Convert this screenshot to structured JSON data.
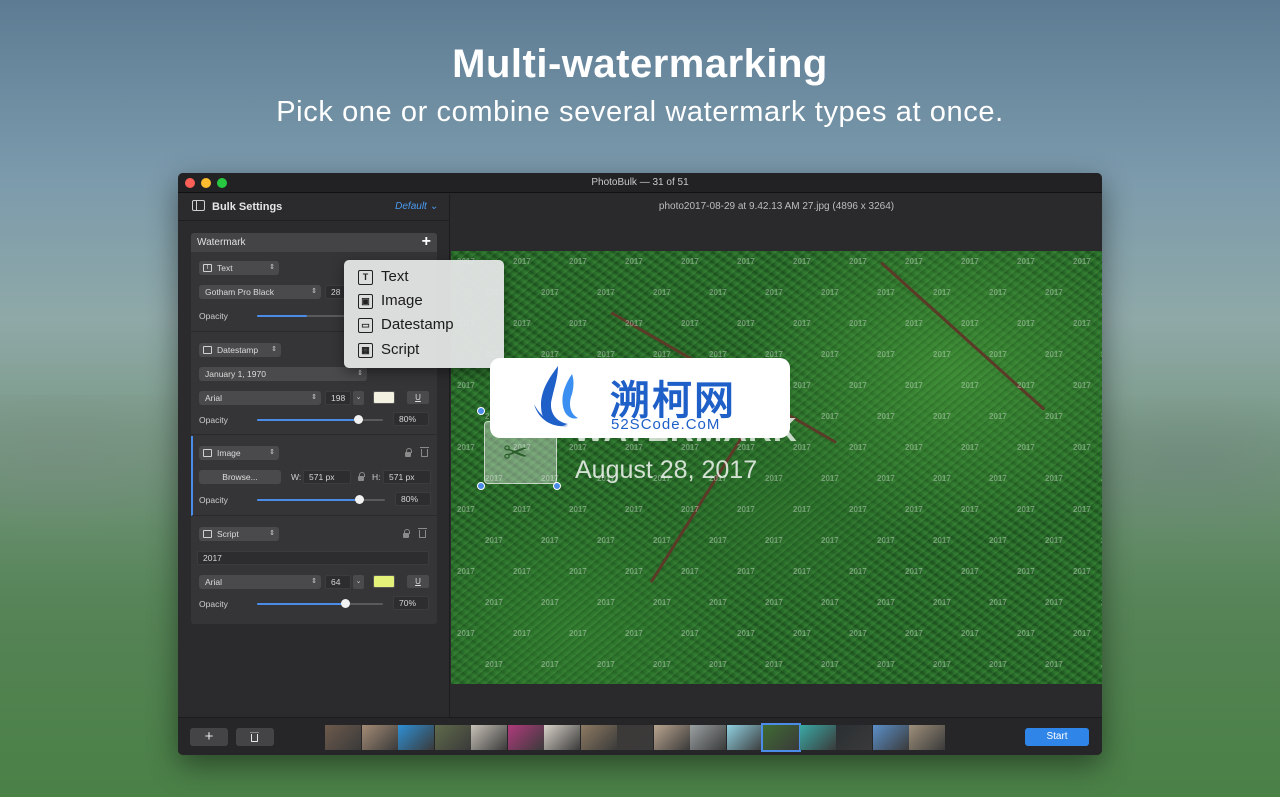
{
  "hero": {
    "title": "Multi-watermarking",
    "subtitle": "Pick one or combine several watermark types at once."
  },
  "window": {
    "title": "PhotoBulk — 31 of 51"
  },
  "sidebar": {
    "title": "Bulk Settings",
    "preset": "Default",
    "panel_title": "Watermark",
    "text_section": {
      "type": "Text",
      "font": "Gotham Pro Black",
      "size_partial": "28",
      "opacity_label": "Opacity",
      "opacity": 0.55
    },
    "datestamp_section": {
      "type": "Datestamp",
      "date_format": "January 1, 1970",
      "font": "Arial",
      "size": "198",
      "underline_label": "U",
      "color": "#f3f1e2",
      "opacity_label": "Opacity",
      "opacity_value": "80%",
      "opacity": 0.8
    },
    "image_section": {
      "type": "Image",
      "browse_label": "Browse...",
      "width_label": "W:",
      "width_value": "571 px",
      "height_label": "H:",
      "height_value": "571 px",
      "opacity_label": "Opacity",
      "opacity_value": "80%",
      "opacity": 0.8
    },
    "script_section": {
      "type": "Script",
      "script_value": "2017",
      "font": "Arial",
      "size": "64",
      "underline_label": "U",
      "color": "#e4f27a",
      "opacity_label": "Opacity",
      "opacity_value": "70%",
      "opacity": 0.7
    }
  },
  "popup": {
    "items": [
      {
        "label": "Text",
        "icon": "T"
      },
      {
        "label": "Image",
        "icon": "▣"
      },
      {
        "label": "Datestamp",
        "icon": "▭"
      },
      {
        "label": "Script",
        "icon": "▦"
      }
    ]
  },
  "preview": {
    "filename": "photo2017-08-29 at 9.42.13 AM 27.jpg (4896 x 3264)",
    "watermark_text": "WATERMARK",
    "watermark_date": "August 28, 2017",
    "tiled_text": "2017"
  },
  "overlay": {
    "cn_text": "溯柯网",
    "en_text": "52SCode.CoM"
  },
  "bottombar": {
    "add_label": "+",
    "start_label": "Start",
    "thumb_colors": [
      "#6d5a4c",
      "#a48b75",
      "#2e8fd4",
      "#5f6a4a",
      "#c7c2b8",
      "#b03a7c",
      "#d8d2c8",
      "#8d7a62",
      "#3c3a38",
      "#b9a48e",
      "#9aa0a2",
      "#8fd0e0",
      "#3f6b32",
      "#3aa9a5",
      "#2a2f33",
      "#5b8fc9",
      "#9e8f7a"
    ],
    "selected_index": 12
  }
}
